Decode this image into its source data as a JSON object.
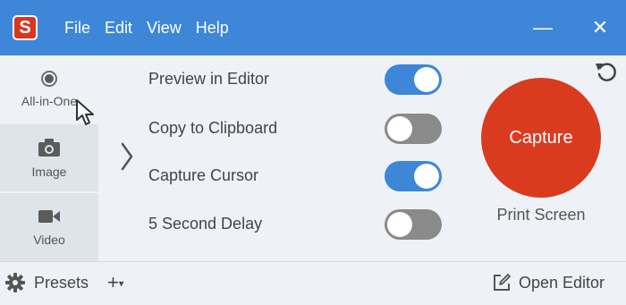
{
  "app": {
    "logo_letter": "S",
    "menu": [
      "File",
      "Edit",
      "View",
      "Help"
    ],
    "minimize_glyph": "—",
    "close_glyph": "✕"
  },
  "modes": [
    {
      "label": "All-in-One",
      "icon": "radio-icon",
      "selected": true
    },
    {
      "label": "Image",
      "icon": "camera-icon",
      "selected": false
    },
    {
      "label": "Video",
      "icon": "video-camera-icon",
      "selected": false
    }
  ],
  "options": [
    {
      "label": "Preview in Editor",
      "enabled": true
    },
    {
      "label": "Copy to Clipboard",
      "enabled": false
    },
    {
      "label": "Capture Cursor",
      "enabled": true
    },
    {
      "label": "5 Second Delay",
      "enabled": false
    }
  ],
  "capture": {
    "label": "Capture",
    "shortcut": "Print Screen",
    "color": "#da3b1f"
  },
  "footer": {
    "presets_label": "Presets",
    "add_label": "+",
    "open_editor_label": "Open Editor"
  },
  "colors": {
    "titlebar": "#3d86d8",
    "toggle_on": "#3d86d8",
    "toggle_off": "#8a8a8a",
    "background": "#eef2f6"
  }
}
